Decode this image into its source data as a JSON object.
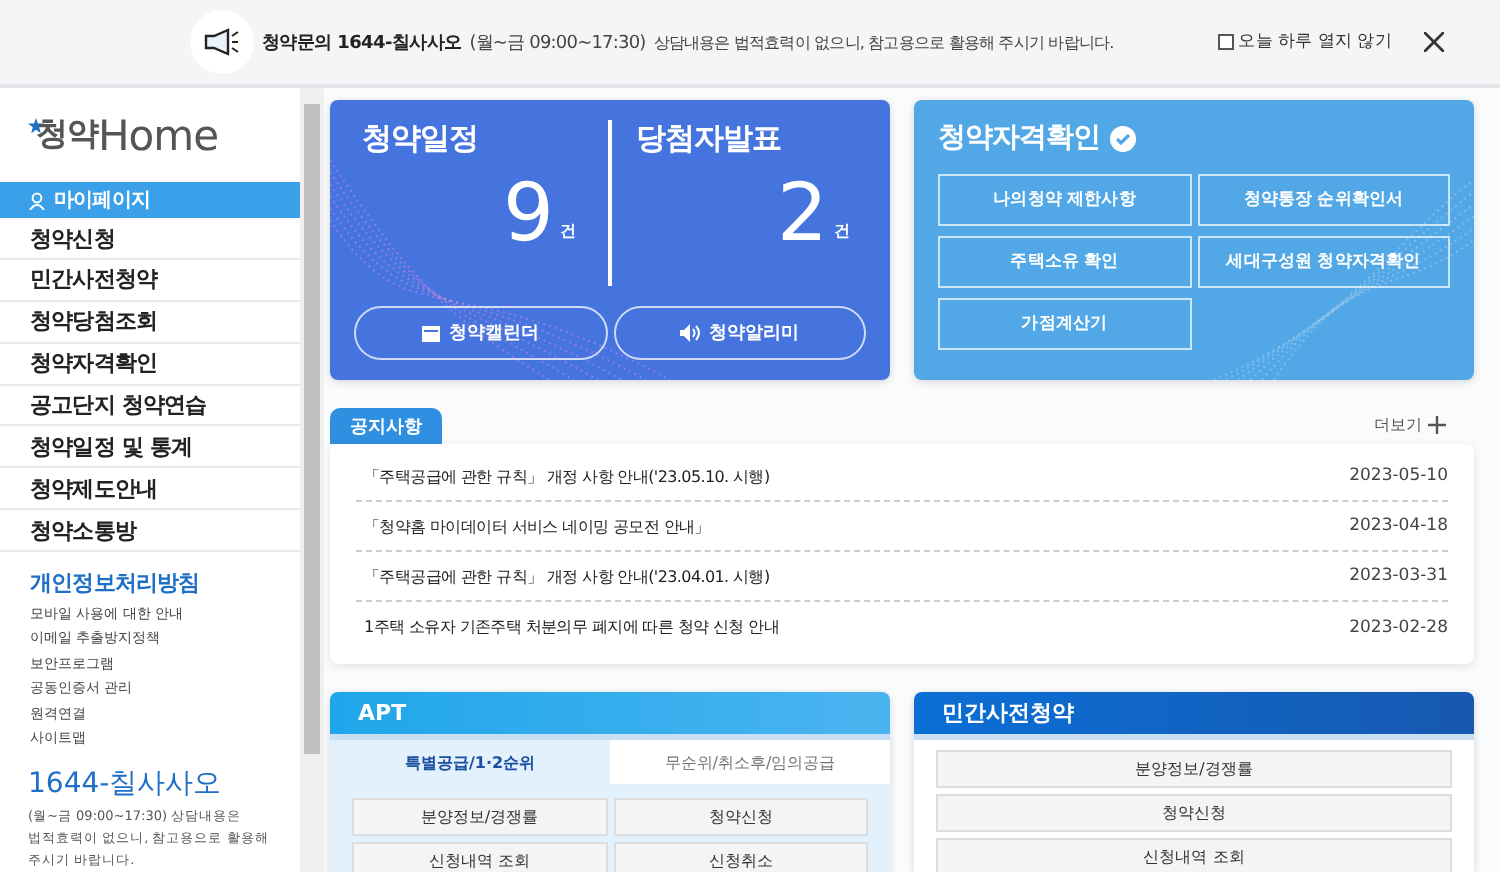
{
  "notice_bar": {
    "title": "청약문의 1644-칠사사오",
    "hours": "(월~금 09:00~17:30)",
    "text": "상담내용은 법적효력이 없으니, 참고용으로 활용해 주시기 바랍니다.",
    "dont_show": {
      "label": "오늘 하루 열지 않기",
      "checked": false
    }
  },
  "sidebar": {
    "logo": {
      "prefix": "청약",
      "suffix": "Home"
    },
    "menu": [
      {
        "label": "마이페이지",
        "selected": true
      },
      {
        "label": "청약신청",
        "selected": false
      },
      {
        "label": "민간사전청약",
        "selected": false
      },
      {
        "label": "청약당첨조회",
        "selected": false
      },
      {
        "label": "청약자격확인",
        "selected": false
      },
      {
        "label": "공고단지 청약연습",
        "selected": false
      },
      {
        "label": "청약일정 및 통계",
        "selected": false
      },
      {
        "label": "청약제도안내",
        "selected": false
      },
      {
        "label": "청약소통방",
        "selected": false
      }
    ],
    "privacy_title": "개인정보처리방침",
    "links": [
      "모바일 사용에 대한 안내",
      "이메일 추출방지정책",
      "보안프로그램",
      "공동인증서 관리",
      "원격연결",
      "사이트맵"
    ],
    "phone": "1644-칠사사오",
    "phone_note": [
      "(월~금 09:00~17:30) 상담내용은",
      "법적효력이 없으니, 참고용으로 활용해",
      "주시기 바랍니다."
    ]
  },
  "schedule_card": {
    "stats": [
      {
        "title": "청약일정",
        "count": "9",
        "unit": "건"
      },
      {
        "title": "당첨자발표",
        "count": "2",
        "unit": "건"
      }
    ],
    "buttons": [
      {
        "label": "청약캘린더",
        "kind": "calendar"
      },
      {
        "label": "청약알리미",
        "kind": "speaker"
      }
    ]
  },
  "eligibility_card": {
    "title": "청약자격확인",
    "buttons": [
      "나의청약 제한사항",
      "청약통장 순위확인서",
      "주택소유 확인",
      "세대구성원 청약자격확인",
      "가점계산기"
    ]
  },
  "notices": {
    "tab": "공지사항",
    "more": "더보기",
    "items": [
      {
        "title": "「주택공급에 관한 규칙」 개정 사항 안내('23.05.10. 시행)",
        "date": "2023-05-10"
      },
      {
        "title": "「청약홈 마이데이터 서비스 네이밍 공모전 안내」",
        "date": "2023-04-18"
      },
      {
        "title": "「주택공급에 관한 규칙」 개정 사항 안내('23.04.01. 시행)",
        "date": "2023-03-31"
      },
      {
        "title": "1주택 소유자 기존주택 처분의무 폐지에 따른 청약 신청 안내",
        "date": "2023-02-28"
      }
    ]
  },
  "apt_panel": {
    "title": "APT",
    "tabs": [
      {
        "label": "특별공급/1·2순위",
        "selected": true
      },
      {
        "label": "무순위/취소후/임의공급",
        "selected": false
      }
    ],
    "buttons": [
      "분양정보/경쟁률",
      "청약신청",
      "신청내역 조회",
      "신청취소"
    ]
  },
  "private_panel": {
    "title": "민간사전청약",
    "buttons": [
      "분양정보/경쟁률",
      "청약신청",
      "신청내역 조회"
    ]
  }
}
